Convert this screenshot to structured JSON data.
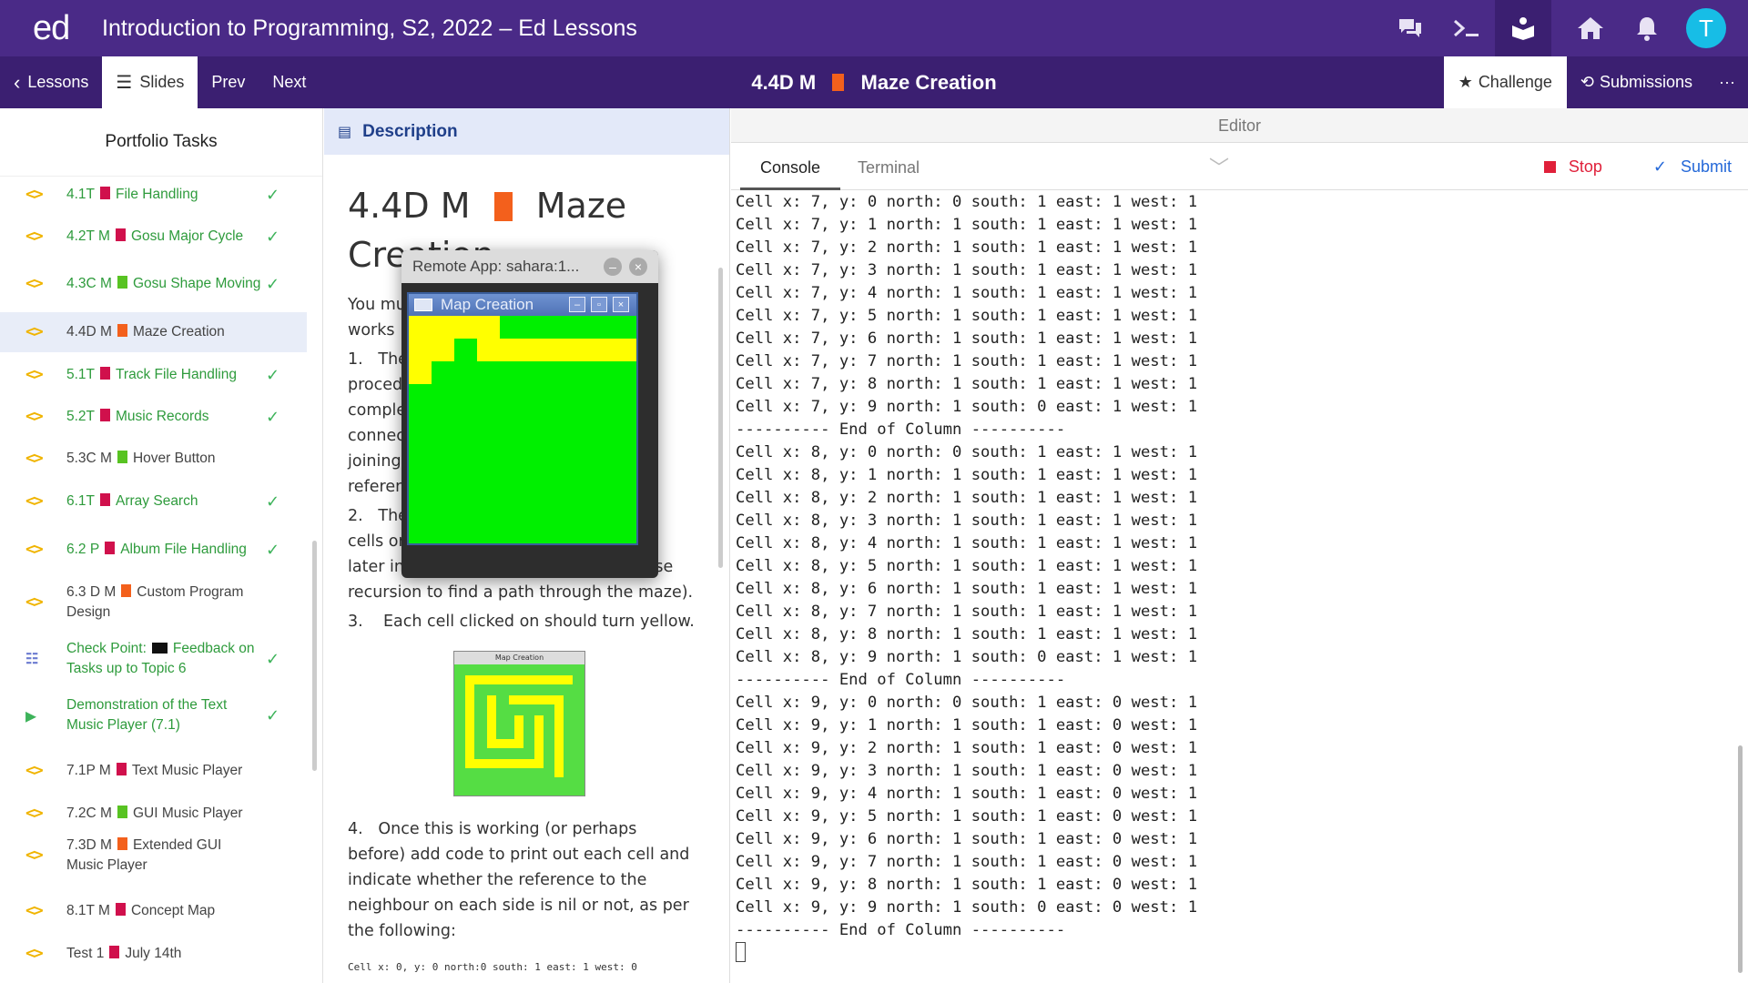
{
  "topbar": {
    "logo": "ed",
    "title": "Introduction to Programming, S2, 2022 – Ed Lessons",
    "avatar": "T",
    "icons": [
      "discussion-icon",
      "terminal-icon",
      "lessons-icon",
      "home-icon",
      "bell-icon"
    ]
  },
  "subbar": {
    "lessons": "Lessons",
    "slides": "Slides",
    "prev": "Prev",
    "next": "Next",
    "lesson_code": "4.4D M",
    "lesson_name": "Maze Creation",
    "challenge": "Challenge",
    "submissions": "Submissions",
    "more": "···"
  },
  "sidebar": {
    "title": "Portfolio Tasks",
    "items": [
      {
        "code": "<>",
        "label": "4.1T",
        "icon_color": "red",
        "name": "File Handling",
        "done": "✓"
      },
      {
        "code": "<>",
        "label": "4.2T M",
        "icon_color": "red",
        "name": "Gosu Major Cycle",
        "done": "✓"
      },
      {
        "code": "<>",
        "label": "4.3C M",
        "icon_color": "green",
        "name": "Gosu Shape Moving",
        "done": "✓"
      },
      {
        "code": "<>",
        "label": "4.4D M",
        "icon_color": "orange",
        "name": "Maze Creation",
        "done": ""
      },
      {
        "code": "<>",
        "label": "5.1T",
        "icon_color": "red",
        "name": "Track File Handling",
        "done": "✓"
      },
      {
        "code": "<>",
        "label": "5.2T",
        "icon_color": "red",
        "name": "Music Records",
        "done": "✓"
      },
      {
        "code": "<>",
        "label": "5.3C M",
        "icon_color": "green",
        "name": "Hover Button",
        "done": ""
      },
      {
        "code": "<>",
        "label": "6.1T",
        "icon_color": "red",
        "name": "Array Search",
        "done": "✓"
      },
      {
        "code": "<>",
        "label": "6.2 P",
        "icon_color": "red",
        "name": "Album File Handling",
        "done": "✓"
      },
      {
        "code": "<>",
        "label": "6.3 D M",
        "icon_color": "orange",
        "name": "Custom Program Design",
        "done": ""
      },
      {
        "code": "",
        "label": "Check Point:",
        "icon_color": "black",
        "name": "Feedback on Tasks up to Topic 6",
        "done": "✓"
      },
      {
        "code": "",
        "label": "",
        "icon_color": "",
        "name": "Demonstration of the Text Music Player (7.1)",
        "done": "✓"
      },
      {
        "code": "<>",
        "label": "7.1P M",
        "icon_color": "red",
        "name": "Text Music Player",
        "done": ""
      },
      {
        "code": "<>",
        "label": "7.2C M",
        "icon_color": "green",
        "name": "GUI Music Player",
        "done": ""
      },
      {
        "code": "<>",
        "label": "7.3D M",
        "icon_color": "orange",
        "name": "Extended GUI Music Player",
        "done": ""
      },
      {
        "code": "<>",
        "label": "8.1T M",
        "icon_color": "red",
        "name": "Concept Map",
        "done": ""
      },
      {
        "code": "<>",
        "label": "Test 1",
        "icon_color": "red",
        "name": "July 14th",
        "done": ""
      }
    ]
  },
  "description": {
    "header": "Description",
    "title_code": "4.4D M",
    "title_name": "Maze Creation",
    "lines": [
      "You mu",
      "works",
      "1.   The",
      "proced                                         be",
      "comple",
      "connec",
      "joining                                         g",
      "referen",
      "2.   The                                          on",
      "cells or                                          d",
      "later in the Maze Search task we will use",
      "recursion to find a path through the maze).",
      "3.    Each cell clicked on should turn yellow."
    ],
    "thumb_title": "Map Creation",
    "lines2": [
      "4.   Once this is working (or perhaps",
      "before) add code to print out each cell and",
      "indicate whether the reference to the",
      "neighbour on each side is nil or not, as per",
      "the following:"
    ],
    "code_sample": "Cell x: 0, y: 0 north:0 south: 1 east: 1 west: 0"
  },
  "editor": {
    "header": "Editor",
    "tabs": [
      "Console",
      "Terminal"
    ],
    "stop": "Stop",
    "submit": "Submit",
    "console_lines": [
      "Cell x: 7, y: 0 north: 0 south: 1 east: 1 west: 1",
      "Cell x: 7, y: 1 north: 1 south: 1 east: 1 west: 1",
      "Cell x: 7, y: 2 north: 1 south: 1 east: 1 west: 1",
      "Cell x: 7, y: 3 north: 1 south: 1 east: 1 west: 1",
      "Cell x: 7, y: 4 north: 1 south: 1 east: 1 west: 1",
      "Cell x: 7, y: 5 north: 1 south: 1 east: 1 west: 1",
      "Cell x: 7, y: 6 north: 1 south: 1 east: 1 west: 1",
      "Cell x: 7, y: 7 north: 1 south: 1 east: 1 west: 1",
      "Cell x: 7, y: 8 north: 1 south: 1 east: 1 west: 1",
      "Cell x: 7, y: 9 north: 1 south: 0 east: 1 west: 1",
      "---------- End of Column ----------",
      "Cell x: 8, y: 0 north: 0 south: 1 east: 1 west: 1",
      "Cell x: 8, y: 1 north: 1 south: 1 east: 1 west: 1",
      "Cell x: 8, y: 2 north: 1 south: 1 east: 1 west: 1",
      "Cell x: 8, y: 3 north: 1 south: 1 east: 1 west: 1",
      "Cell x: 8, y: 4 north: 1 south: 1 east: 1 west: 1",
      "Cell x: 8, y: 5 north: 1 south: 1 east: 1 west: 1",
      "Cell x: 8, y: 6 north: 1 south: 1 east: 1 west: 1",
      "Cell x: 8, y: 7 north: 1 south: 1 east: 1 west: 1",
      "Cell x: 8, y: 8 north: 1 south: 1 east: 1 west: 1",
      "Cell x: 8, y: 9 north: 1 south: 0 east: 1 west: 1",
      "---------- End of Column ----------",
      "Cell x: 9, y: 0 north: 0 south: 1 east: 0 west: 1",
      "Cell x: 9, y: 1 north: 1 south: 1 east: 0 west: 1",
      "Cell x: 9, y: 2 north: 1 south: 1 east: 0 west: 1",
      "Cell x: 9, y: 3 north: 1 south: 1 east: 0 west: 1",
      "Cell x: 9, y: 4 north: 1 south: 1 east: 0 west: 1",
      "Cell x: 9, y: 5 north: 1 south: 1 east: 0 west: 1",
      "Cell x: 9, y: 6 north: 1 south: 1 east: 0 west: 1",
      "Cell x: 9, y: 7 north: 1 south: 1 east: 0 west: 1",
      "Cell x: 9, y: 8 north: 1 south: 1 east: 0 west: 1",
      "Cell x: 9, y: 9 north: 1 south: 0 east: 0 west: 1",
      "---------- End of Column ----------"
    ]
  },
  "remote_app": {
    "title": "Remote App: sahara:1...",
    "inner_title": "Map Creation",
    "maze_colors": {
      "floor": "#00f000",
      "visited": "#ffff00"
    }
  },
  "colors": {
    "brand": "#4a2a87",
    "brand_dark": "#3b1f71",
    "avatar": "#17bde6",
    "done_green": "#2e9b3c",
    "stop_red": "#e0203a",
    "submit_blue": "#2468d8"
  }
}
